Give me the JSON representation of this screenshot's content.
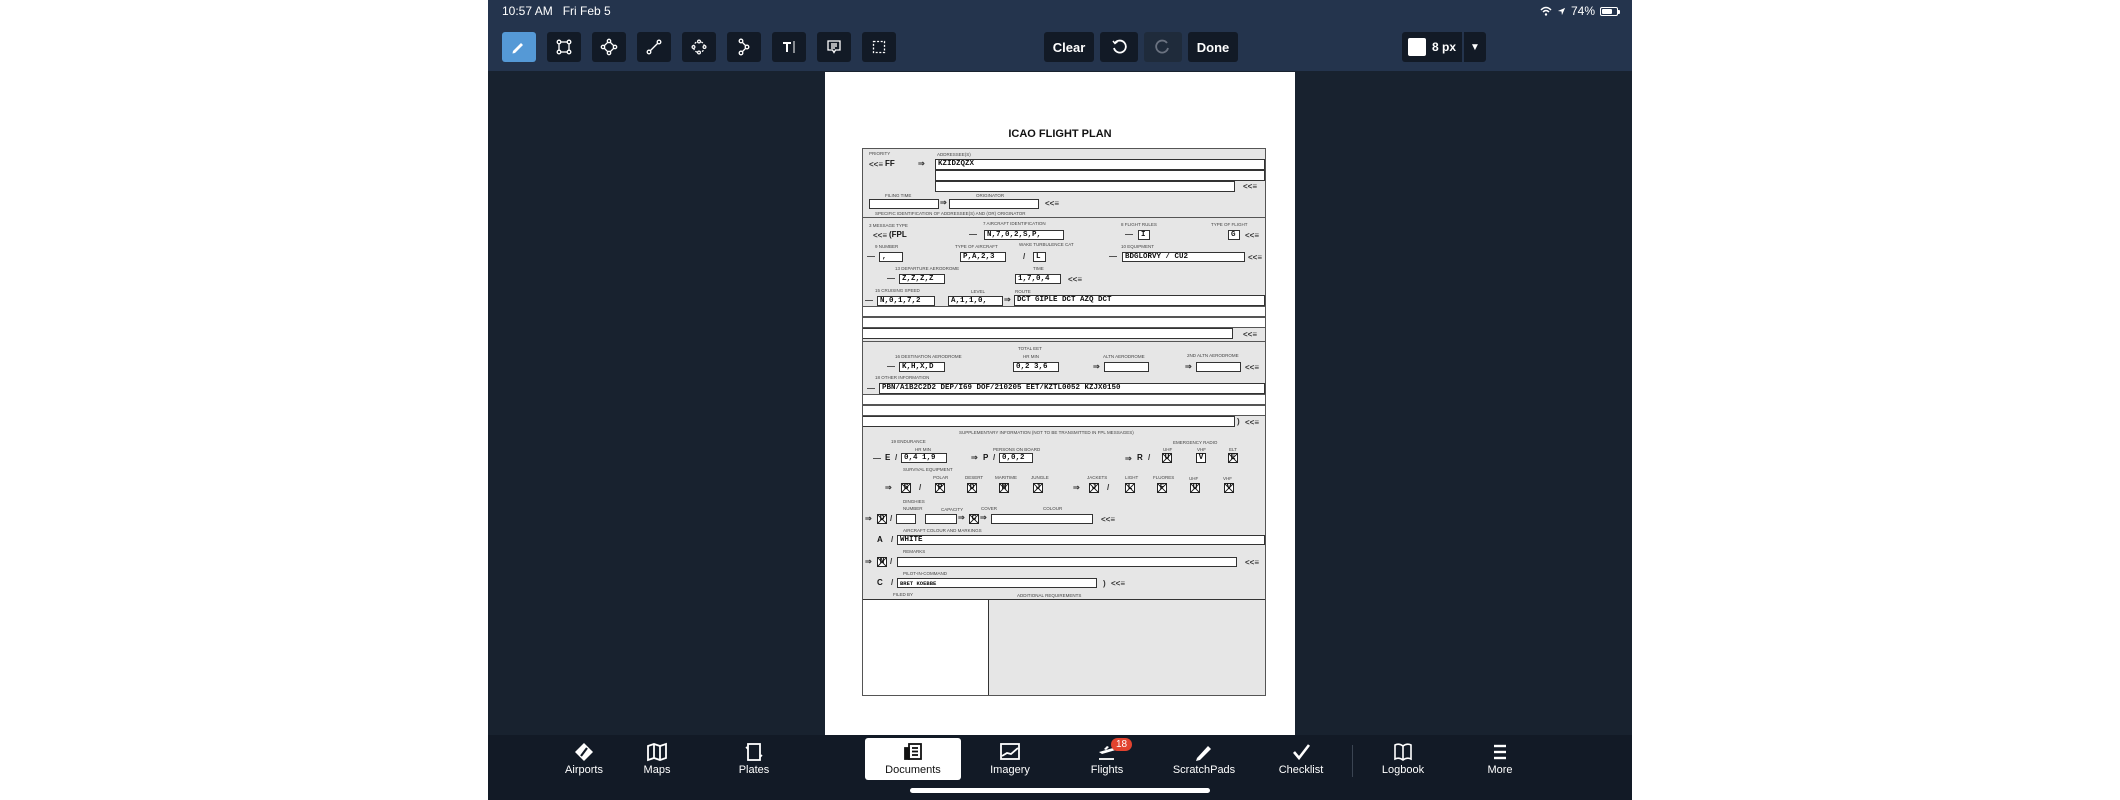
{
  "status_bar": {
    "time": "10:57 AM",
    "date": "Fri Feb 5",
    "battery": "74%",
    "battery_level": 0.74
  },
  "toolbar": {
    "tools": [
      {
        "name": "pen-tool",
        "icon": "pencil-icon",
        "active": true
      },
      {
        "name": "rectangle-tool",
        "icon": "rectangle-shape-icon"
      },
      {
        "name": "ellipse-tool",
        "icon": "ellipse-shape-icon"
      },
      {
        "name": "line-tool",
        "icon": "line-shape-icon"
      },
      {
        "name": "polygon-tool",
        "icon": "polygon-shape-icon"
      },
      {
        "name": "polyline-tool",
        "icon": "polyline-icon"
      },
      {
        "name": "text-tool",
        "icon": "text-icon",
        "label": "T"
      },
      {
        "name": "note-tool",
        "icon": "comment-icon"
      },
      {
        "name": "select-tool",
        "icon": "selection-icon"
      }
    ],
    "stroke_color": "#ffffff",
    "stroke_width": "8 px",
    "clear_label": "Clear",
    "done_label": "Done"
  },
  "document": {
    "title": "ICAO FLIGHT PLAN",
    "labels": {
      "priority": "PRIORITY",
      "addressees": "ADDRESSEE(S)",
      "filing_time": "FILING TIME",
      "originator": "ORIGINATOR",
      "specific_id": "SPECIFIC IDENTIFICATION OF ADDRESSEE(S) AND (OR) ORIGINATOR",
      "message_type": "3 MESSAGE TYPE",
      "aircraft_id": "7 AIRCRAFT IDENTIFICATION",
      "flight_rules": "8 FLIGHT RULES",
      "type_of_flight": "TYPE OF FLIGHT",
      "number": "9 NUMBER",
      "type_of_aircraft": "TYPE OF AIRCRAFT",
      "wake_turbulence": "WAKE TURBULENCE CAT",
      "equipment": "10 EQUIPMENT",
      "departure": "13 DEPARTURE AERODROME",
      "time": "TIME",
      "cruising_speed": "15 CRUISING SPEED",
      "level": "LEVEL",
      "route": "ROUTE",
      "total_eet": "TOTAL EET",
      "destination": "16 DESTINATION AERODROME",
      "hr_min": "HR MIN",
      "altn": "ALTN AERODROME",
      "altn2": "2ND ALTN AERODROME",
      "other_info": "18 OTHER INFORMATION",
      "supplementary": "SUPPLEMENTARY INFORMATION (NOT TO BE TRANSMITTED IN FPL MESSAGES)",
      "endurance": "19 ENDURANCE",
      "persons_on_board": "PERSONS ON BOARD",
      "emergency_radio": "EMERGENCY RADIO",
      "uhf": "UHF",
      "vhf": "VHF",
      "elt": "ELT",
      "survival_equipment": "SURVIVAL EQUIPMENT",
      "polar": "POLAR",
      "desert": "DESERT",
      "maritime": "MARITIME",
      "jungle": "JUNGLE",
      "jackets": "JACKETS",
      "light": "LIGHT",
      "fluores": "FLUORES",
      "dinghies": "DINGHIES",
      "dinghy_number": "NUMBER",
      "capacity": "CAPACITY",
      "cover": "COVER",
      "colour": "COLOUR",
      "aircraft_colour": "AIRCRAFT COLOUR AND MARKINGS",
      "remarks": "REMARKS",
      "pic": "PILOT-IN-COMMAND",
      "filed_by": "FILED BY",
      "additional_req": "ADDITIONAL REQUIREMENTS"
    },
    "symbols": {
      "start": "<<≡",
      "arrow": "⇒",
      "dash": "—",
      "slash": "/",
      "close": ")"
    },
    "values": {
      "priority": "FF",
      "addressee": "KZIDZQZX",
      "message_type": "(FPL",
      "aircraft_id": "N,7,0,2,S,P,",
      "flight_rules": "I",
      "type_of_flight": "G",
      "number": ",",
      "type_of_aircraft": "P,A,2,3",
      "wake_turbulence": "L",
      "equipment": "BDGLORVY / CU2",
      "departure": "Z,Z,Z,Z",
      "time": "1,7,0,4",
      "cruising_speed": "N,0,1,7,2",
      "level": "A,1,1,0,",
      "route": "DCT GIPLE DCT AZQ DCT",
      "destination": "K,H,X,D",
      "total_eet": "0,2 3,6",
      "other_info": "PBN/A1B2C2D2 DEP/I69 DOF/210205 EET/KZTL0052 KZJX0150",
      "endurance": "0,4 1,9",
      "persons_on_board": "0,0,2",
      "radio": [
        "U",
        "V",
        "E"
      ],
      "survival": [
        "S",
        "P",
        "D",
        "M",
        "J"
      ],
      "jackets": [
        "J",
        "L",
        "F",
        "U",
        "V"
      ],
      "dinghies": "D",
      "cover": "C",
      "aircraft_colour": "WHITE",
      "remarks_flag": "N",
      "pic": "BRET KOEBBE",
      "marks": {
        "A": "A",
        "C": "C",
        "E": "E",
        "P": "P",
        "R": "R"
      }
    }
  },
  "tabbar": {
    "tabs": [
      {
        "label": "Airports",
        "icon": "airport-diamond-icon"
      },
      {
        "label": "Maps",
        "icon": "map-icon"
      },
      {
        "label": "Plates",
        "icon": "plates-icon"
      },
      {
        "label": "Documents",
        "icon": "documents-icon",
        "active": true
      },
      {
        "label": "Imagery",
        "icon": "imagery-icon"
      },
      {
        "label": "Flights",
        "icon": "airplane-departure-icon",
        "badge": "18"
      },
      {
        "label": "ScratchPads",
        "icon": "pencil-icon"
      },
      {
        "label": "Checklist",
        "icon": "checkmark-icon"
      },
      {
        "label": "Logbook",
        "icon": "book-icon"
      },
      {
        "label": "More",
        "icon": "menu-icon"
      }
    ]
  }
}
